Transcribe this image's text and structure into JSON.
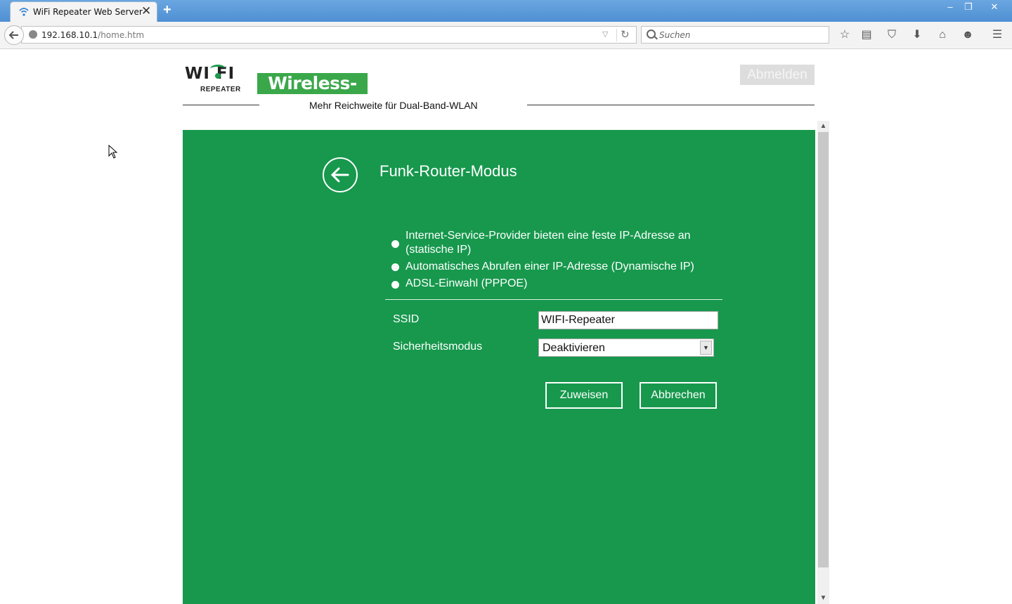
{
  "browser": {
    "tab_title": "WiFi Repeater Web Server",
    "tab_close": "✕",
    "new_tab": "+",
    "url_host": "192.168.10.1",
    "url_path": "/home.htm",
    "search_placeholder": "Suchen",
    "window_controls": [
      "–",
      "❐",
      "✕"
    ],
    "toolbar_icons": [
      "star-icon",
      "reading-list-icon",
      "pocket-icon",
      "download-icon",
      "home-icon",
      "chat-icon",
      "menu-icon"
    ]
  },
  "header": {
    "logo_text": "WI FI",
    "logo_subtext": "REPEATER",
    "brand": "Wireless-AC",
    "tagline": "Mehr Reichweite für Dual-Band-WLAN",
    "logout_label": "Abmelden"
  },
  "panel": {
    "title": "Funk-Router-Modus",
    "options": [
      {
        "label_line1": "Internet-Service-Provider bieten eine feste IP-Adresse an",
        "label_line2": "(statische IP)",
        "selected": false
      },
      {
        "label_line1": "Automatisches Abrufen einer IP-Adresse (Dynamische IP)",
        "selected": true
      },
      {
        "label_line1": "ADSL-Einwahl (PPPOE)",
        "selected": false
      }
    ],
    "ssid_label": "SSID",
    "ssid_value": "WIFI-Repeater",
    "security_label": "Sicherheitsmodus",
    "security_value": "Deaktivieren",
    "apply_label": "Zuweisen",
    "cancel_label": "Abbrechen"
  },
  "colors": {
    "panel_green": "#17984d",
    "brand_green": "#3aa84a",
    "titlebar_blue": "#4f90d3"
  }
}
